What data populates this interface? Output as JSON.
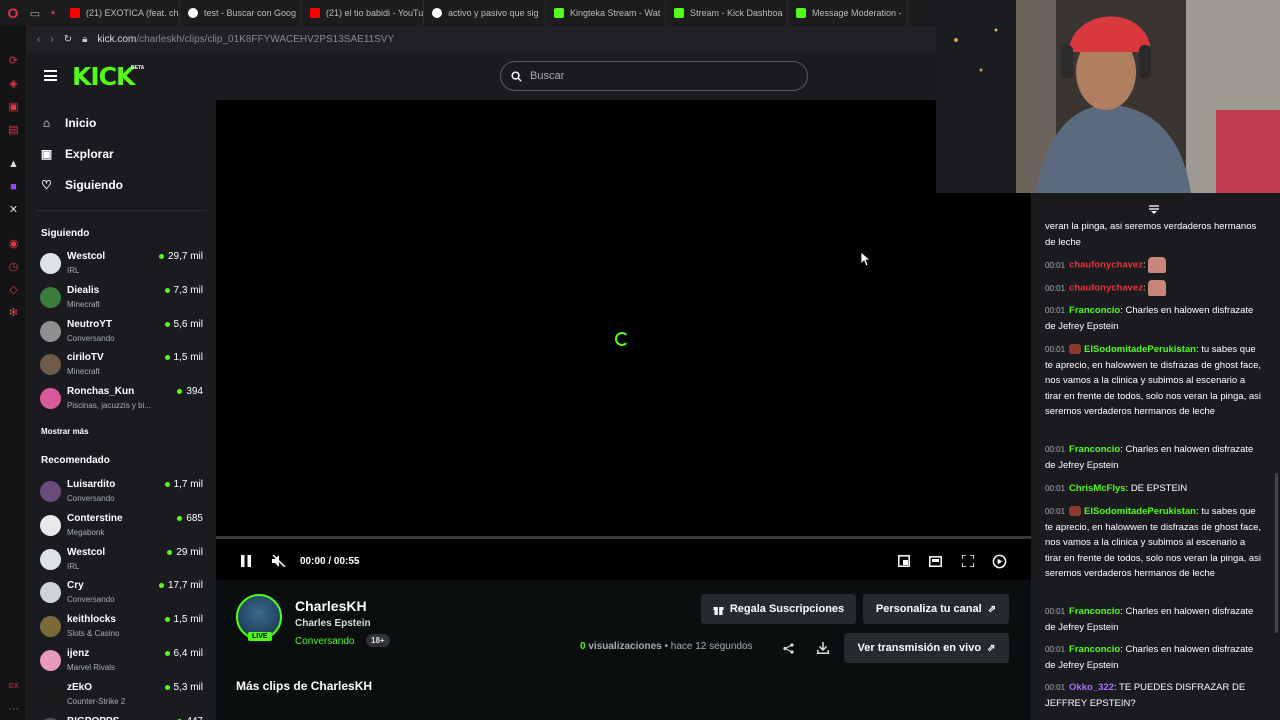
{
  "browser": {
    "tabs": [
      {
        "label": "(21) EXOTICA (feat. cha",
        "icon": "youtube-icon",
        "fav": "yt"
      },
      {
        "label": "test - Buscar con Goog",
        "icon": "google-icon",
        "fav": "g"
      },
      {
        "label": "(21) el tio babidi - YouTu",
        "icon": "youtube-icon",
        "fav": "yt"
      },
      {
        "label": "activo y pasivo que sig",
        "icon": "google-icon",
        "fav": "g"
      },
      {
        "label": "Kingteka Stream - Wat",
        "icon": "kick-icon",
        "fav": "k"
      },
      {
        "label": "Stream - Kick Dashboa",
        "icon": "kick-icon",
        "fav": "k"
      },
      {
        "label": "Message Moderation - ",
        "icon": "kick-icon",
        "fav": "k"
      }
    ],
    "url_host": "kick.com",
    "url_path": "/charleskh/clips/clip_01K8FFYWACEHV2PS13SAE11SVY"
  },
  "header": {
    "logo": "KICK",
    "beta": "BETA",
    "search_placeholder": "Buscar"
  },
  "sidebar": {
    "nav": [
      {
        "label": "Inicio",
        "icon": "home-icon"
      },
      {
        "label": "Explorar",
        "icon": "explore-icon"
      },
      {
        "label": "Siguiendo",
        "icon": "heart-icon"
      }
    ],
    "following_title": "Siguiendo",
    "following": [
      {
        "name": "Westcol",
        "category": "IRL",
        "viewers": "29,7 mil"
      },
      {
        "name": "Diealis",
        "category": "Minecraft",
        "viewers": "7,3 mil"
      },
      {
        "name": "NeutroYT",
        "category": "Conversando",
        "viewers": "5,6 mil"
      },
      {
        "name": "ciriloTV",
        "category": "Minecraft",
        "viewers": "1,5 mil"
      },
      {
        "name": "Ronchas_Kun",
        "category": "Piscinas, jacuzzis y bi...",
        "viewers": "394"
      }
    ],
    "show_more": "Mostrar más",
    "recommended_title": "Recomendado",
    "recommended": [
      {
        "name": "Luisardito",
        "category": "Conversando",
        "viewers": "1,7 mil"
      },
      {
        "name": "Conterstine",
        "category": "Megabonk",
        "viewers": "685"
      },
      {
        "name": "Westcol",
        "category": "IRL",
        "viewers": "29 mil"
      },
      {
        "name": "Cry",
        "category": "Conversando",
        "viewers": "17,7 mil"
      },
      {
        "name": "keithlocks",
        "category": "Slots & Casino",
        "viewers": "1,5 mil"
      },
      {
        "name": "ijenz",
        "category": "Marvel Rivals",
        "viewers": "6,4 mil"
      },
      {
        "name": "zEkO",
        "category": "Counter-Strike 2",
        "viewers": "5,3 mil"
      },
      {
        "name": "BIGPOPPS",
        "category": "",
        "viewers": "447"
      }
    ]
  },
  "player": {
    "time_current": "00:00",
    "time_total": "00:55",
    "progress": 0
  },
  "clip": {
    "channel": "CharlesKH",
    "title": "Charles Epstein",
    "category": "Conversando",
    "age": "18+",
    "live": "LIVE",
    "gift_button": "Regala Suscripciones",
    "customize_button": "Personaliza tu canal",
    "views_count": "0",
    "views_label": "visualizaciones",
    "ago": "• hace 12 segundos",
    "watch_live_button": "Ver transmisión en vivo",
    "more_clips": "Más clips de CharlesKH"
  },
  "chat": {
    "messages": [
      {
        "time": "",
        "user": "",
        "color": "#ffffff",
        "text": "veran la pinga, asi seremos verdaderos hermanos de leche"
      },
      {
        "time": "00:01",
        "user": "chaufonychavez",
        "color": "#e8323c",
        "text": "",
        "emote": true
      },
      {
        "time": "00:01",
        "user": "chaufonychavez",
        "color": "#e8323c",
        "text": "",
        "emote": true
      },
      {
        "time": "00:01",
        "user": "Franconcio",
        "color": "#53fc18",
        "text": "Charles en halowen disfrazate de Jefrey Epstein"
      },
      {
        "time": "00:01",
        "user": "ElSodomitadePerukistan",
        "color": "#53fc18",
        "text": "tu sabes que te aprecio, en halowwen te disfrazas de ghost face, nos vamos a la clinica y subimos al escenario a tirar en frente de todos, solo nos veran la pinga, asi seremos verdaderos hermanos de leche",
        "badge": true
      },
      {
        "time": "00:01",
        "user": "Franconcio",
        "color": "#53fc18",
        "text": "Charles en halowen disfrazate de Jefrey Epstein"
      },
      {
        "time": "00:01",
        "user": "ChrisMcFlys",
        "color": "#53fc18",
        "text": "DE EPSTEIN"
      },
      {
        "time": "00:01",
        "user": "ElSodomitadePerukistan",
        "color": "#53fc18",
        "text": "tu sabes que te aprecio, en halowwen te disfrazas de ghost face, nos vamos a la clinica y subimos al escenario a tirar en frente de todos, solo nos veran la pinga, asi seremos verdaderos hermanos de leche",
        "badge": true
      },
      {
        "time": "00:01",
        "user": "Franconcio",
        "color": "#53fc18",
        "text": "Charles en halowen disfrazate de Jefrey Epstein"
      },
      {
        "time": "00:01",
        "user": "Franconcio",
        "color": "#53fc18",
        "text": "Charles en halowen disfrazate de Jefrey Epstein"
      },
      {
        "time": "00:01",
        "user": "Okko_322",
        "color": "#b06bff",
        "text": "TE PUEDES DISFRAZAR DE JEFFREY EPSTEIN?"
      }
    ]
  },
  "colors": {
    "brand": "#53fc18",
    "background": "#0b0e0f",
    "panel": "#191b1f"
  }
}
